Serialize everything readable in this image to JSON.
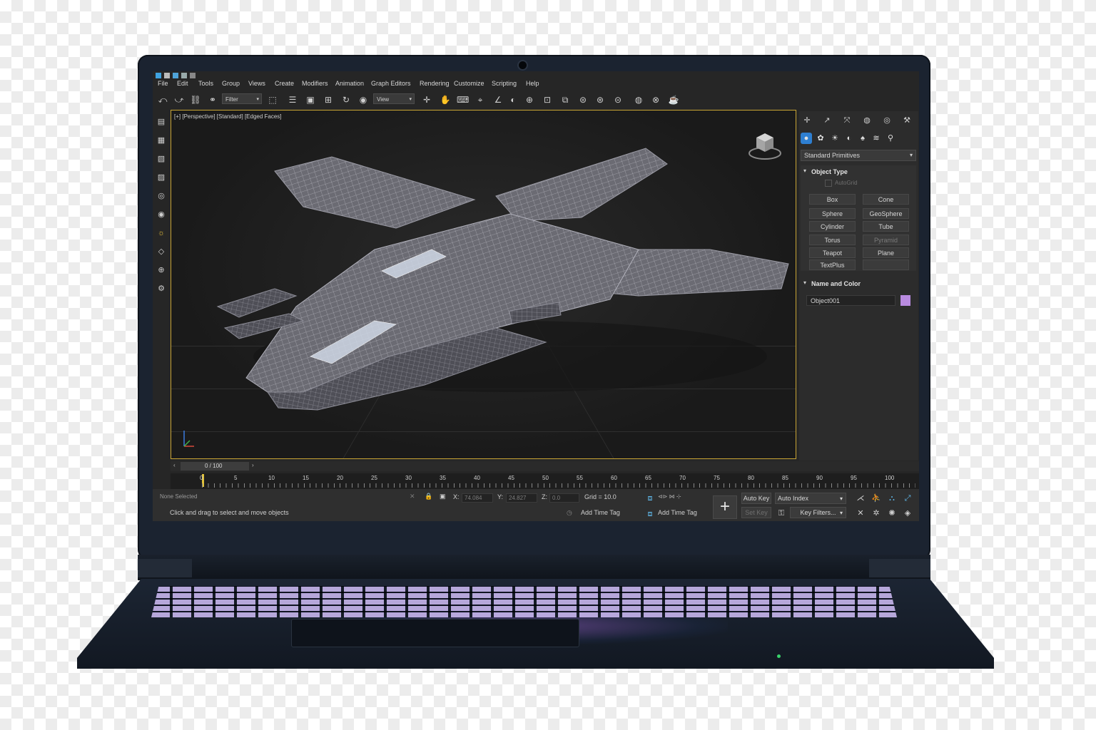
{
  "menu": [
    "File",
    "Edit",
    "Tools",
    "Group",
    "Views",
    "Create",
    "Modifiers",
    "Animation",
    "Graph Editors",
    "Rendering",
    "Customize",
    "Scripting",
    "Help"
  ],
  "toolbar": {
    "filter_dropdown": "Filter",
    "view_dropdown": "View"
  },
  "viewport": {
    "label": "[+] [Perspective] [Standard] [Edged Faces]"
  },
  "panel": {
    "category": "Standard Primitives",
    "object_type_title": "Object Type",
    "autogrid": "AutoGrid",
    "primitives": [
      {
        "label": "Box"
      },
      {
        "label": "Cone"
      },
      {
        "label": "Sphere"
      },
      {
        "label": "GeoSphere"
      },
      {
        "label": "Cylinder"
      },
      {
        "label": "Tube"
      },
      {
        "label": "Torus"
      },
      {
        "label": "Pyramid"
      },
      {
        "label": "Teapot"
      },
      {
        "label": "Plane"
      },
      {
        "label": "TextPlus"
      }
    ],
    "name_color_title": "Name and Color",
    "object_name": "Object001",
    "object_color": "#b98be0"
  },
  "timeline": {
    "frame_counter": "0 / 100",
    "ticks": [
      "0",
      "5",
      "10",
      "15",
      "20",
      "25",
      "30",
      "35",
      "40",
      "45",
      "50",
      "55",
      "60",
      "65",
      "70",
      "75",
      "80",
      "85",
      "90",
      "95",
      "100"
    ]
  },
  "status": {
    "selection": "None Selected",
    "prompt": "Click and drag to select and move objects",
    "x_label": "X:",
    "x_value": "74.084",
    "y_label": "Y:",
    "y_value": "24.827",
    "z_label": "Z:",
    "z_value": "0.0",
    "grid": "Grid = 10.0",
    "add_time_tag": "Add Time Tag",
    "add_time_tag_2": "Add Time Tag",
    "auto_key": "Auto Key",
    "auto_dropdown": "Auto Index",
    "set_key": "Set Key",
    "key_filters": "Key Filters..."
  },
  "colors": {
    "accent": "#c9a534",
    "highlight": "#2e7fd1"
  }
}
